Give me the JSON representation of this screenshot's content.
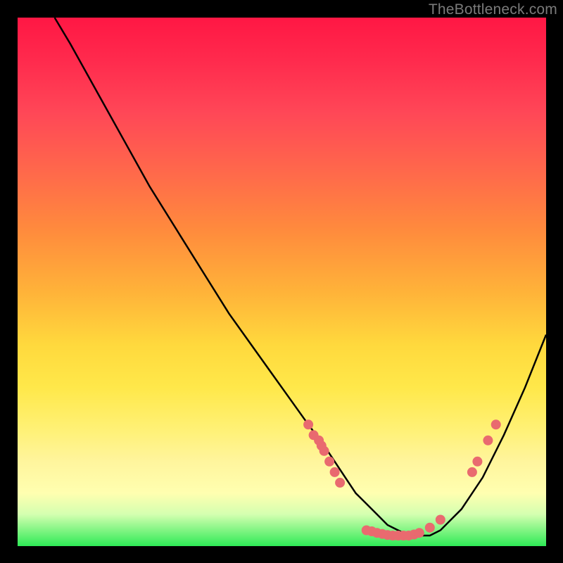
{
  "watermark": "TheBottleneck.com",
  "chart_data": {
    "type": "line",
    "title": "",
    "xlabel": "",
    "ylabel": "",
    "xlim": [
      0,
      100
    ],
    "ylim": [
      0,
      100
    ],
    "grid": false,
    "series": [
      {
        "name": "curve",
        "x": [
          7,
          10,
          15,
          20,
          25,
          30,
          35,
          40,
          45,
          50,
          55,
          58,
          60,
          62,
          64,
          66,
          68,
          70,
          72,
          74,
          76,
          78,
          80,
          84,
          88,
          92,
          96,
          100
        ],
        "y": [
          100,
          95,
          86,
          77,
          68,
          60,
          52,
          44,
          37,
          30,
          23,
          19,
          16,
          13,
          10,
          8,
          6,
          4,
          3,
          2,
          2,
          2,
          3,
          7,
          13,
          21,
          30,
          40
        ]
      }
    ],
    "markers": [
      {
        "x": 55,
        "y": 23
      },
      {
        "x": 56,
        "y": 21
      },
      {
        "x": 57,
        "y": 20
      },
      {
        "x": 57.5,
        "y": 19
      },
      {
        "x": 58,
        "y": 18
      },
      {
        "x": 59,
        "y": 16
      },
      {
        "x": 60,
        "y": 14
      },
      {
        "x": 61,
        "y": 12
      },
      {
        "x": 66,
        "y": 3
      },
      {
        "x": 67,
        "y": 2.8
      },
      {
        "x": 68,
        "y": 2.5
      },
      {
        "x": 69,
        "y": 2.3
      },
      {
        "x": 70,
        "y": 2.1
      },
      {
        "x": 71,
        "y": 2
      },
      {
        "x": 72,
        "y": 2
      },
      {
        "x": 73,
        "y": 2
      },
      {
        "x": 74,
        "y": 2
      },
      {
        "x": 75,
        "y": 2.2
      },
      {
        "x": 76,
        "y": 2.5
      },
      {
        "x": 78,
        "y": 3.5
      },
      {
        "x": 80,
        "y": 5
      },
      {
        "x": 86,
        "y": 14
      },
      {
        "x": 87,
        "y": 16
      },
      {
        "x": 89,
        "y": 20
      },
      {
        "x": 90.5,
        "y": 23
      }
    ],
    "marker_color": "#e96a6f",
    "curve_color": "#000000"
  }
}
